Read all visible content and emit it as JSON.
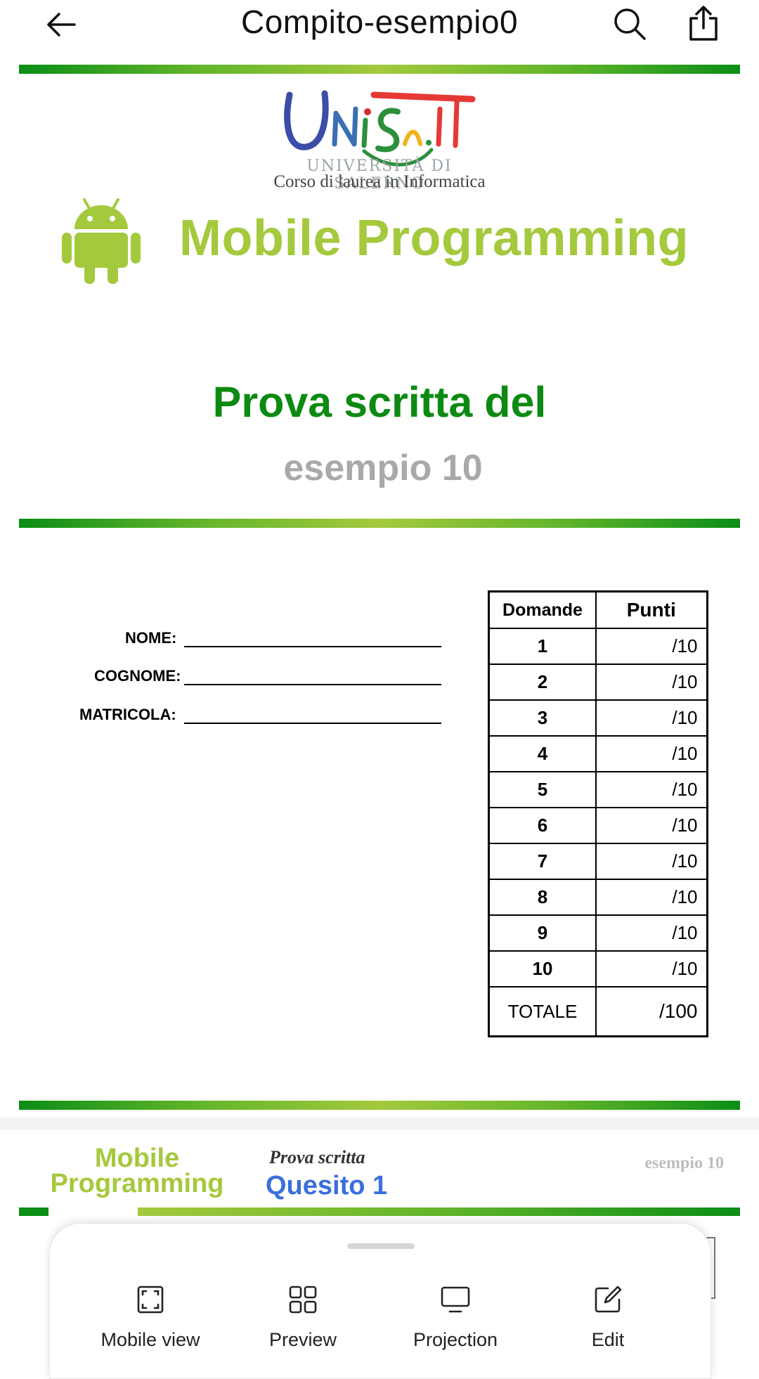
{
  "app_bar": {
    "title": "Compito-esempio0",
    "back_icon": "arrow-left-icon",
    "search_icon": "search-icon",
    "share_icon": "share-icon"
  },
  "document": {
    "page1": {
      "logo_text": "UNISA.IT",
      "logo_subtitle": "UNIVERSITÀ DI SALERNO",
      "degree": "Corso di laurea in Informatica",
      "course": "Mobile Programming",
      "exam_title": "Prova scritta del",
      "exam_date": "esempio 10",
      "fields": [
        {
          "label": "NOME:"
        },
        {
          "label": "COGNOME:"
        },
        {
          "label": "MATRICOLA:"
        }
      ],
      "score_table": {
        "headers": [
          "Domande",
          "Punti"
        ],
        "rows": [
          [
            "1",
            "/10"
          ],
          [
            "2",
            "/10"
          ],
          [
            "3",
            "/10"
          ],
          [
            "4",
            "/10"
          ],
          [
            "5",
            "/10"
          ],
          [
            "6",
            "/10"
          ],
          [
            "7",
            "/10"
          ],
          [
            "8",
            "/10"
          ],
          [
            "9",
            "/10"
          ],
          [
            "10",
            "/10"
          ]
        ],
        "total": [
          "TOTALE",
          "/100"
        ]
      }
    },
    "page2": {
      "course_line1": "Mobile",
      "course_line2": "Programming",
      "exam_label": "Prova scritta",
      "question": "Quesito 1",
      "exam_date": "esempio 10"
    }
  },
  "bottom_sheet": {
    "tools": [
      {
        "label": "Mobile view",
        "icon": "fullscreen-icon"
      },
      {
        "label": "Preview",
        "icon": "grid-icon"
      },
      {
        "label": "Projection",
        "icon": "monitor-icon"
      },
      {
        "label": "Edit",
        "icon": "edit-icon"
      }
    ]
  },
  "colors": {
    "accent_green": "#0b8e16",
    "light_green": "#a4c93d",
    "question_blue": "#3a6fdc"
  }
}
